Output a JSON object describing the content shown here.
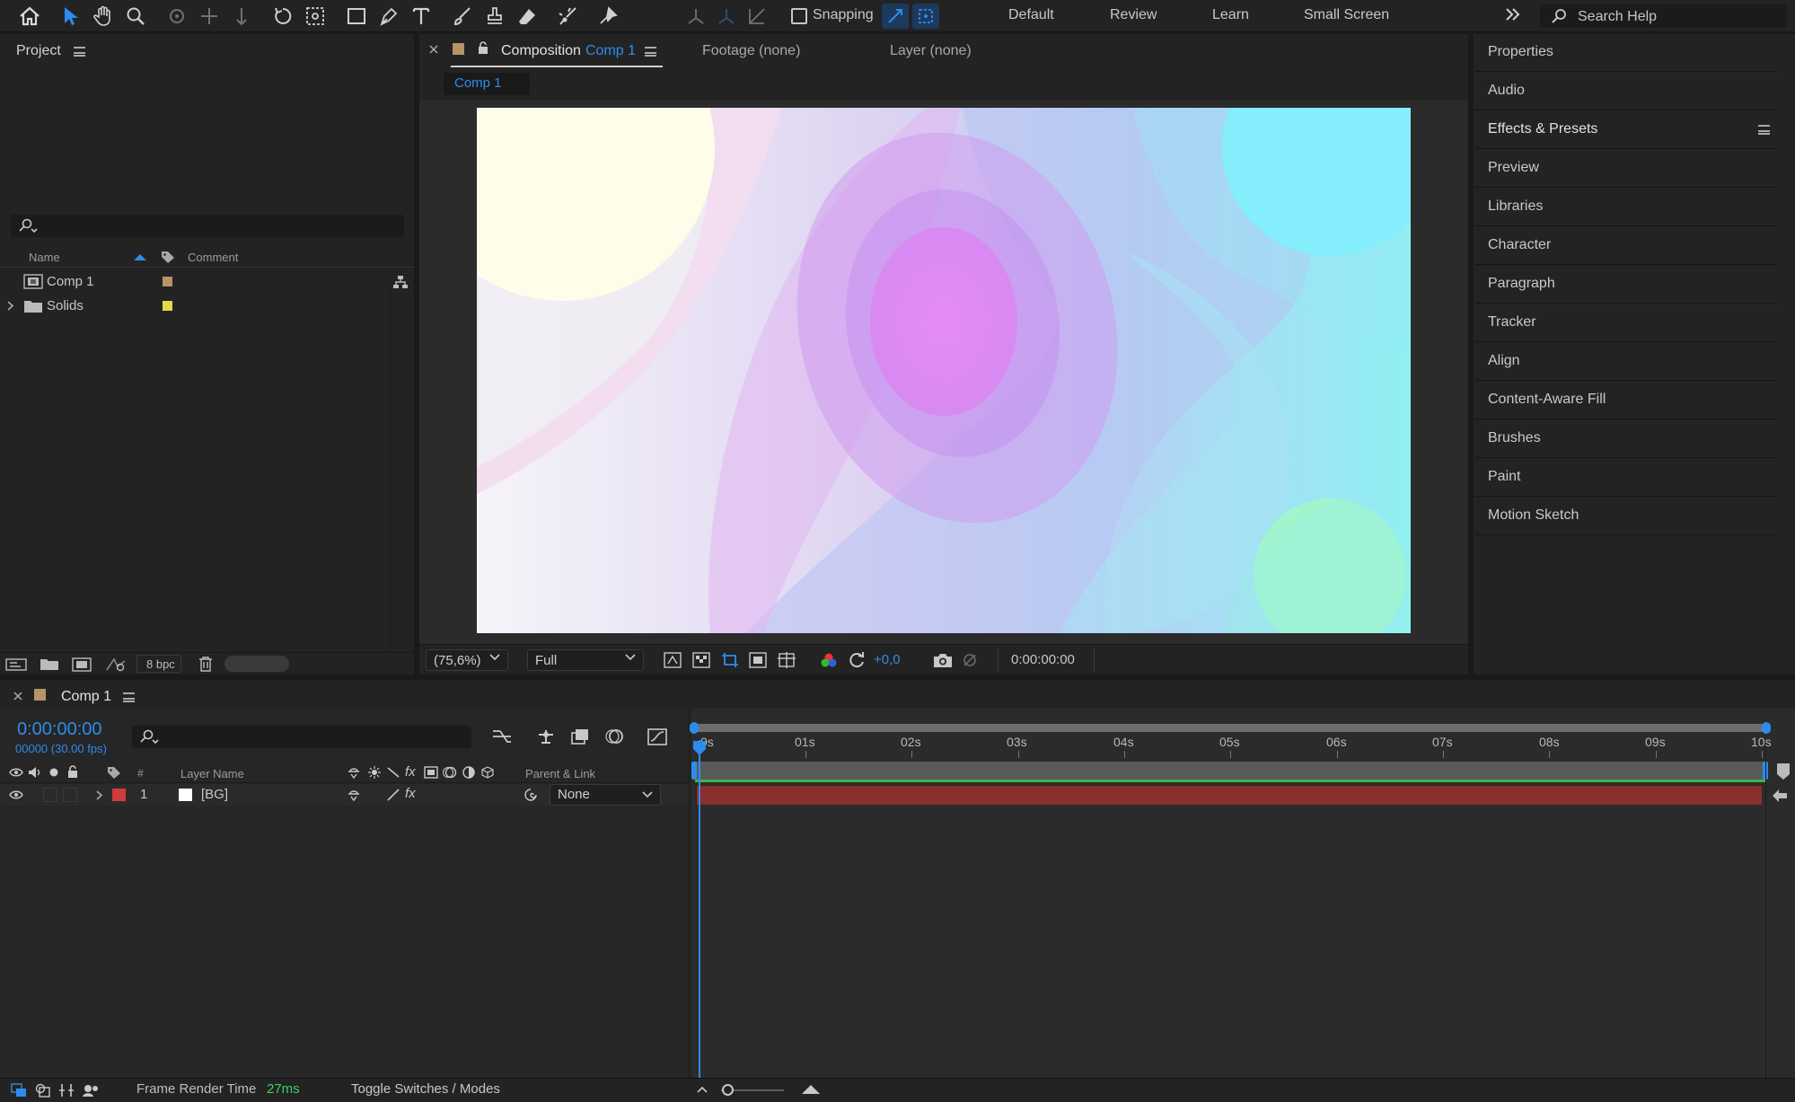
{
  "toolbar": {
    "snapping_label": "Snapping",
    "workspaces": [
      "Default",
      "Review",
      "Learn",
      "Small Screen"
    ],
    "search_placeholder": "Search Help",
    "accent": "#2d8ceb"
  },
  "project": {
    "title": "Project",
    "col_name": "Name",
    "col_comment": "Comment",
    "items": [
      {
        "label": "Comp 1",
        "color": "#b7926a"
      },
      {
        "label": "Solids",
        "color": "#e5d84a"
      }
    ],
    "bpc": "8 bpc"
  },
  "composition": {
    "tab_prefix": "Composition",
    "tab_name": "Comp 1",
    "footage_tab": "Footage (none)",
    "layer_tab": "Layer (none)",
    "breadcrumb": "Comp 1",
    "zoom": "(75,6%)",
    "resolution": "Full",
    "exposure": "+0,0",
    "timecode": "0:00:00:00"
  },
  "panels": [
    "Properties",
    "Audio",
    "Effects & Presets",
    "Preview",
    "Libraries",
    "Character",
    "Paragraph",
    "Tracker",
    "Align",
    "Content-Aware Fill",
    "Brushes",
    "Paint",
    "Motion Sketch"
  ],
  "timeline": {
    "tab": "Comp 1",
    "timecode": "0:00:00:00",
    "frames": "00000 (30.00 fps)",
    "col_layer_name": "Layer Name",
    "col_number": "#",
    "col_parent": "Parent & Link",
    "ticks": [
      "0s",
      "01s",
      "02s",
      "03s",
      "04s",
      "05s",
      "06s",
      "07s",
      "08s",
      "09s",
      "10s"
    ],
    "layers": [
      {
        "index": "1",
        "name": "[BG]",
        "label_color": "#d13b3b",
        "parent": "None"
      }
    ],
    "bar_color": "#8b2e2e",
    "work_area_color": "#3bb54a"
  },
  "status": {
    "render_label": "Frame Render Time",
    "render_value": "27ms",
    "toggle_label": "Toggle Switches / Modes"
  }
}
